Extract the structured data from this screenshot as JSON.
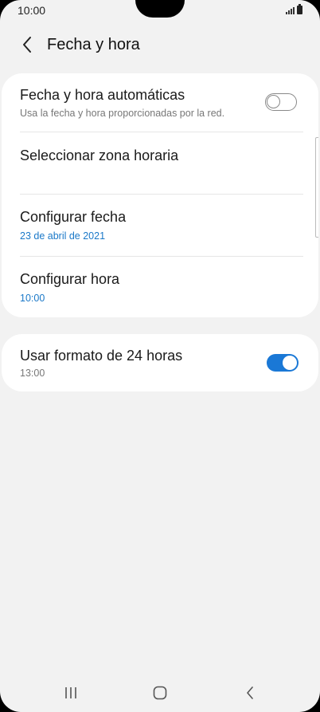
{
  "status_bar": {
    "time": "10:00",
    "icons": [
      "signal-icon",
      "battery-icon"
    ]
  },
  "header": {
    "title": "Fecha y hora",
    "back_icon": "chevron-left-icon"
  },
  "settings_group_1": {
    "items": [
      {
        "title": "Fecha y hora automáticas",
        "subtitle": "Usa la fecha y hora proporcionadas por la red.",
        "toggle": false
      },
      {
        "title": "Seleccionar zona horaria"
      },
      {
        "title": "Configurar fecha",
        "value": "23 de abril de 2021"
      },
      {
        "title": "Configurar hora",
        "value": "10:00"
      }
    ]
  },
  "settings_group_2": {
    "items": [
      {
        "title": "Usar formato de 24 horas",
        "subtitle": "13:00",
        "toggle": true
      }
    ]
  },
  "nav_bar": {
    "buttons": [
      "recent-apps-icon",
      "home-icon",
      "back-icon"
    ]
  },
  "colors": {
    "accent": "#1a78d6",
    "value_text": "#1a78c8",
    "background": "#f2f2f2"
  }
}
